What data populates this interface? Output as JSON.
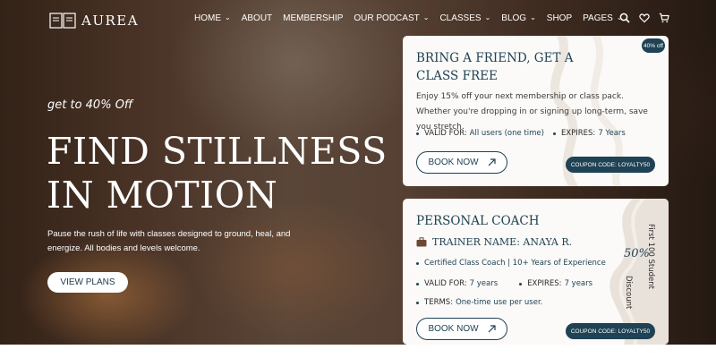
{
  "brand": {
    "name": "AUREA"
  },
  "nav": {
    "items": [
      {
        "label": "HOME",
        "dropdown": true
      },
      {
        "label": "ABOUT",
        "dropdown": false
      },
      {
        "label": "MEMBERSHIP",
        "dropdown": false
      },
      {
        "label": "OUR PODCAST",
        "dropdown": true
      },
      {
        "label": "CLASSES",
        "dropdown": true
      },
      {
        "label": "BLOG",
        "dropdown": true
      },
      {
        "label": "SHOP",
        "dropdown": false
      },
      {
        "label": "PAGES",
        "dropdown": true
      }
    ],
    "icons": [
      "search-icon",
      "heart-icon",
      "cart-icon"
    ]
  },
  "hero": {
    "promo": "get to 40% Off",
    "headline_line1": "FIND STILLNESS",
    "headline_line2": "IN MOTION",
    "description": "Pause the rush of life with classes designed to ground, heal, and energize. All bodies and levels welcome.",
    "cta": "VIEW PLANS"
  },
  "card1": {
    "badge": "40% off",
    "title": "BRING A FRIEND, GET A CLASS FREE",
    "text": "Enjoy 15% off your next membership or class pack. Whether you're dropping in or signing up long-term, save you stretch.",
    "valid_label": "VALID FOR:",
    "valid_value": "All users (one time)",
    "expires_label": "EXPIRES:",
    "expires_value": "7 Years",
    "button": "BOOK NOW",
    "coupon": "COUPON CODE: LOYALTY50"
  },
  "card2": {
    "title": "PERSONAL COACH",
    "trainer": "TRAINER NAME: ANAYA R.",
    "certification": "Certified Class Coach | 10+ Years of Experience",
    "valid_label": "VALID FOR:",
    "valid_value": "7 years",
    "expires_label": "EXPIRES:",
    "expires_value": "7 years",
    "terms_label": "TERMS:",
    "terms_value": "One-time use per user.",
    "button": "BOOK NOW",
    "coupon": "COUPON CODE: LOYALTY50",
    "percent": "50%",
    "discount_label": "Discount",
    "side_label": "First 100 Student"
  },
  "colors": {
    "accent": "#1f4254",
    "card_bg": "#fbfaf8"
  }
}
